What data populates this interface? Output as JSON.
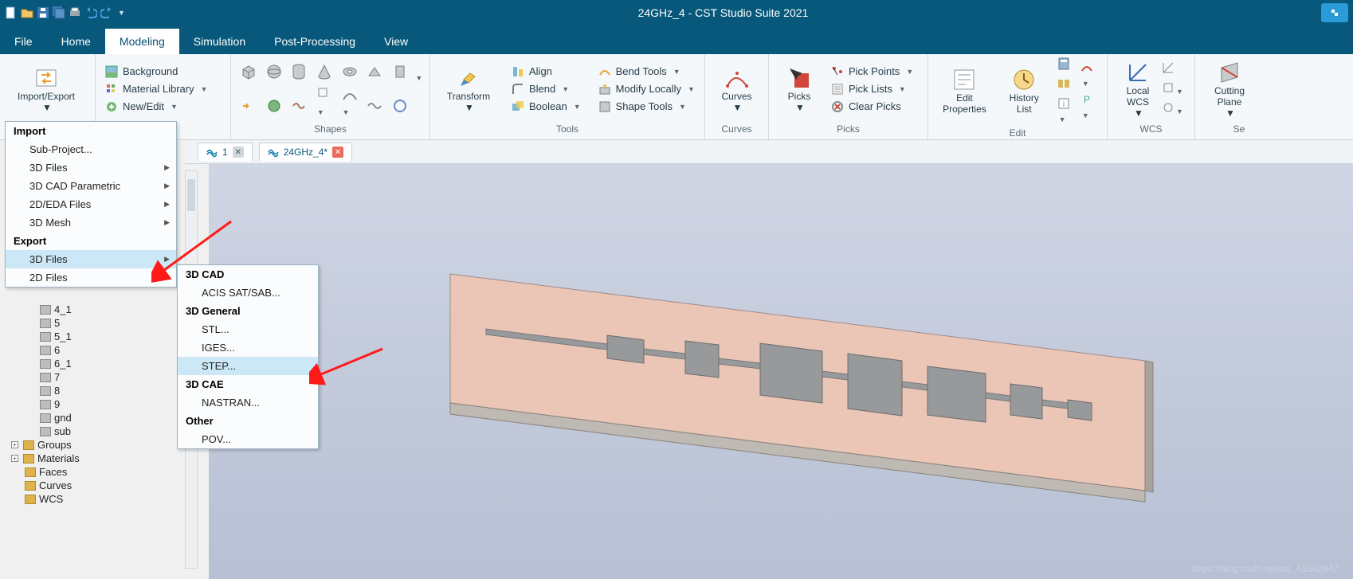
{
  "title": "24GHz_4 - CST Studio Suite 2021",
  "tabs": {
    "file": "File",
    "home": "Home",
    "modeling": "Modeling",
    "simulation": "Simulation",
    "post": "Post-Processing",
    "view": "View"
  },
  "ribbon": {
    "import_export": "Import/Export",
    "materials": {
      "background": "Background",
      "library": "Material Library",
      "newedit": "New/Edit",
      "label": "ils"
    },
    "shapes_label": "Shapes",
    "transform": "Transform",
    "tools": {
      "align": "Align",
      "blend": "Blend",
      "boolean": "Boolean",
      "bend": "Bend Tools",
      "modify": "Modify Locally",
      "shape": "Shape Tools",
      "label": "Tools"
    },
    "curves": {
      "btn": "Curves",
      "label": "Curves"
    },
    "picks": {
      "btn": "Picks",
      "pp": "Pick Points",
      "pl": "Pick Lists",
      "cp": "Clear Picks",
      "label": "Picks"
    },
    "edit": {
      "ep": "Edit\nProperties",
      "hl": "History\nList",
      "label": "Edit"
    },
    "wcs": {
      "lw": "Local\nWCS",
      "label": "WCS"
    },
    "sectional": {
      "cp": "Cutting\nPlane",
      "label": "Se"
    }
  },
  "doc_tabs": {
    "t1": "1",
    "t2": "24GHz_4*"
  },
  "menu1": {
    "h1": "Import",
    "i1": "Sub-Project...",
    "i2": "3D Files",
    "i3": "3D CAD Parametric",
    "i4": "2D/EDA Files",
    "i5": "3D Mesh",
    "h2": "Export",
    "e1": "3D Files",
    "e2": "2D Files"
  },
  "menu2": {
    "h1": "3D CAD",
    "m1": "ACIS SAT/SAB...",
    "h2": "3D General",
    "m2": "STL...",
    "m3": "IGES...",
    "m4": "STEP...",
    "h3": "3D CAE",
    "m5": "NASTRAN...",
    "h4": "Other",
    "m6": "POV..."
  },
  "tree": {
    "c1": "4_1",
    "c2": "5",
    "c3": "5_1",
    "c4": "6",
    "c5": "6_1",
    "c6": "7",
    "c7": "8",
    "c8": "9",
    "c9": "gnd",
    "c10": "sub",
    "g": "Groups",
    "m": "Materials",
    "f": "Faces",
    "cv": "Curves",
    "w": "WCS"
  },
  "watermark": "https://blog.csdn.net/qq_41542947"
}
